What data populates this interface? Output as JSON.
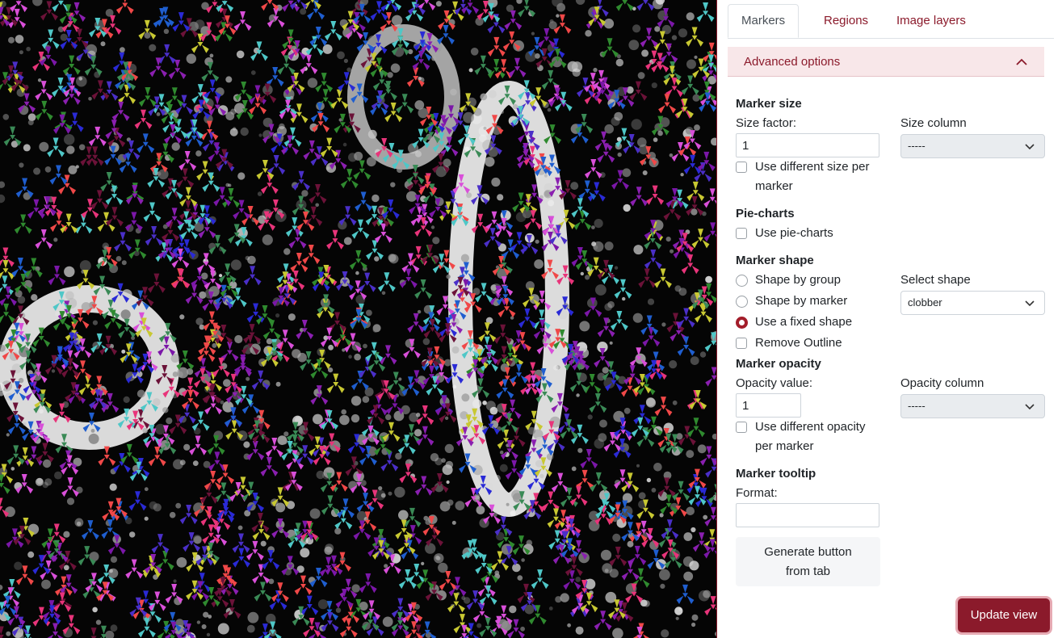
{
  "viewer": {
    "name": "tissue-image-with-markers"
  },
  "tabs": [
    {
      "label": "Markers",
      "active": true
    },
    {
      "label": "Regions",
      "active": false
    },
    {
      "label": "Image layers",
      "active": false
    }
  ],
  "advanced": {
    "label": "Advanced options",
    "expanded": true
  },
  "marker_size": {
    "heading": "Marker size",
    "factor_label": "Size factor:",
    "factor_value": "1",
    "column_label": "Size column",
    "column_value": "-----",
    "diff_label_1": "Use different size per",
    "diff_label_2": "marker",
    "diff_checked": false
  },
  "pie_charts": {
    "heading": "Pie-charts",
    "use_label": "Use pie-charts",
    "checked": false
  },
  "marker_shape": {
    "heading": "Marker shape",
    "options": [
      "Shape by group",
      "Shape by marker",
      "Use a fixed shape"
    ],
    "selected": "Use a fixed shape",
    "select_label": "Select shape",
    "select_value": "clobber",
    "remove_outline": "Remove Outline",
    "remove_outline_checked": false
  },
  "marker_opacity": {
    "heading": "Marker opacity",
    "value_label": "Opacity value:",
    "value": "1",
    "column_label": "Opacity column",
    "column_value": "-----",
    "diff_label_1": "Use different opacity",
    "diff_label_2": "per marker",
    "diff_checked": false
  },
  "marker_tooltip": {
    "heading": "Marker tooltip",
    "format_label": "Format:",
    "format_value": ""
  },
  "buttons": {
    "generate_1": "Generate button",
    "generate_2": "from tab",
    "update": "Update view"
  },
  "colors": {
    "accent": "#8b1a2b",
    "accent_light": "#f8e7e9",
    "marker_palette": [
      "#e8347a",
      "#8a1fb0",
      "#7b17a8",
      "#2a2ad6",
      "#4fc7c7",
      "#c8c832",
      "#2f8a2f",
      "#6b1238",
      "#f04848",
      "#3a8a56",
      "#d94fd9",
      "#4a2fc8",
      "#1f5ecf"
    ]
  }
}
